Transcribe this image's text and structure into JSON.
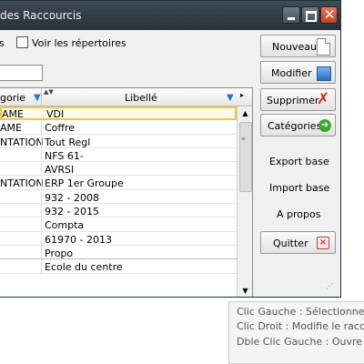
{
  "window": {
    "title": "des Raccourcis",
    "title_buttons": {
      "minimize": "minimize-icon",
      "maximize": "maximize-icon",
      "close": "close-icon"
    }
  },
  "toolbar": {
    "option_label": "s",
    "show_dirs_label": "Voir les répertoires",
    "show_dirs_checked": false,
    "search_value": ""
  },
  "grid": {
    "columns": [
      {
        "label": "gorie",
        "filter_icon": "filter-icon"
      },
      {
        "label": "Libellé",
        "filter_icon": "filter-icon"
      }
    ],
    "sort_indicator": "▲▼",
    "header_arrow": "▸",
    "rows": [
      {
        "category": "AME",
        "label": "VDI",
        "selected": true
      },
      {
        "category": "AME",
        "label": "Coffre",
        "selected": false
      },
      {
        "category": "NTATION",
        "label": "Tout Regl",
        "selected": false
      },
      {
        "category": "",
        "label": "NFS 61-",
        "selected": false
      },
      {
        "category": "",
        "label": "AVRSI",
        "selected": false
      },
      {
        "category": "NTATION",
        "label": "ERP 1er Groupe",
        "selected": false
      },
      {
        "category": "",
        "label": "932 - 2008",
        "selected": false
      },
      {
        "category": "",
        "label": "932 - 2015",
        "selected": false
      },
      {
        "category": "",
        "label": "Compta",
        "selected": false
      },
      {
        "category": "",
        "label": "61970 - 2013",
        "selected": false
      },
      {
        "category": "",
        "label": "Propo",
        "selected": false
      },
      {
        "category": "",
        "label": "Ecole du centre",
        "selected": false
      }
    ],
    "scroll": {
      "up": "▲",
      "down": "▼",
      "grip": "≡"
    }
  },
  "actions": {
    "nouveau": "Nouveau",
    "modifier": "Modifier",
    "supprimer": "Supprimer",
    "categories": "Catégories",
    "export": "Export base",
    "import": "Import base",
    "apropos": "A propos",
    "quitter": "Quitter"
  },
  "icons": {
    "nouveau": "new-document-icon",
    "modifier": "edit-image-icon",
    "supprimer": "delete-x-icon",
    "categories": "go-arrow-icon",
    "quitter": "quit-icon"
  },
  "tooltip": {
    "line1": "Clic Gauche : Sélectionne la",
    "line2": "Clic Droit    : Modifie le racc",
    "line3": "Dble Clic Gauche : Ouvre le"
  },
  "colors": {
    "titlebar": "#2f3b44",
    "selection_border": "#f3c54a",
    "filter_icon": "#2a6fd6",
    "delete_icon": "#d42a12",
    "go_icon": "#3caa2a"
  }
}
